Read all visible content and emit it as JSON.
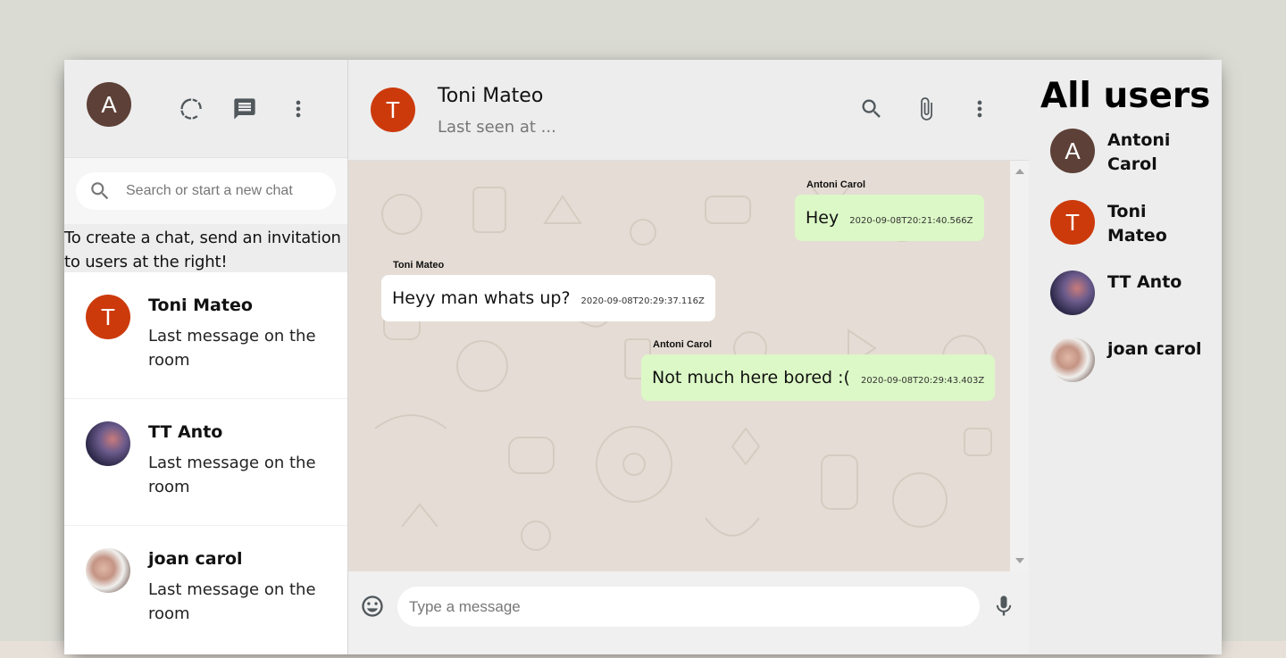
{
  "sidebar": {
    "user_initial": "A",
    "search_placeholder": "Search or start a new chat",
    "invite_text": "To create a chat, send an invitation to users at the right!",
    "chats": [
      {
        "name": "Toni Mateo",
        "initial": "T",
        "last": "Last message on the room",
        "avatar": "orange"
      },
      {
        "name": "TT Anto",
        "initial": "",
        "last": "Last message on the room",
        "avatar": "photo1"
      },
      {
        "name": "joan carol",
        "initial": "",
        "last": "Last message on the room",
        "avatar": "photo2"
      }
    ]
  },
  "chat": {
    "contact_initial": "T",
    "contact_name": "Toni Mateo",
    "last_seen": "Last seen at ...",
    "input_placeholder": "Type a message",
    "messages": [
      {
        "author": "Antoni Carol",
        "text": "Hey",
        "time": "2020-09-08T20:21:40.566Z",
        "sent": true
      },
      {
        "author": "Toni Mateo",
        "text": "Heyy man whats up?",
        "time": "2020-09-08T20:29:37.116Z",
        "sent": false
      },
      {
        "author": "Antoni Carol",
        "text": "Not much here bored :(",
        "time": "2020-09-08T20:29:43.403Z",
        "sent": true
      }
    ]
  },
  "users": {
    "title": "All users",
    "list": [
      {
        "name": "Antoni Carol",
        "initial": "A",
        "avatar": "brown"
      },
      {
        "name": "Toni Mateo",
        "initial": "T",
        "avatar": "orange"
      },
      {
        "name": "TT Anto",
        "initial": "",
        "avatar": "photo1"
      },
      {
        "name": "joan carol",
        "initial": "",
        "avatar": "photo2"
      }
    ]
  },
  "icons": {
    "status": "status-icon",
    "new_chat": "message-icon",
    "menu": "more-vert-icon",
    "search": "search-icon",
    "attach": "paperclip-icon",
    "emoji": "emoji-icon",
    "mic": "mic-icon"
  },
  "colors": {
    "sent_bubble": "#dcf8c6",
    "received_bubble": "#ffffff",
    "chat_background": "#e5ddd5",
    "avatar_orange": "#cc3a0c",
    "avatar_brown": "#5d4037"
  }
}
